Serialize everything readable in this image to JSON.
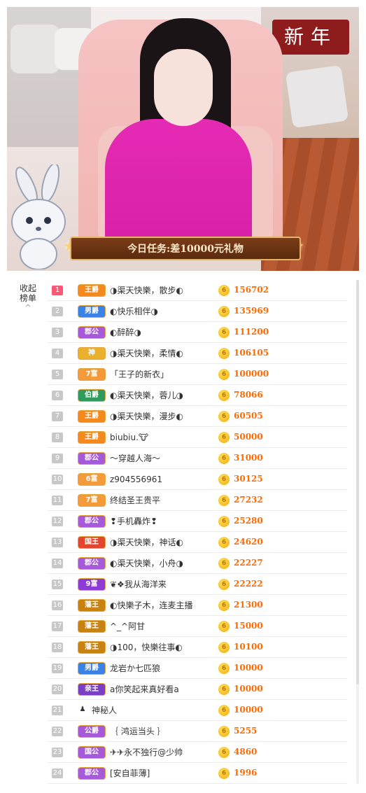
{
  "stream": {
    "task_text": "今日任务:差10000元礼物",
    "sign_text": "新年"
  },
  "sidebar": {
    "collapse_label": "收起",
    "collapse_label2": "榜单",
    "chevron": "^"
  },
  "colors": {
    "top_rank": "#ff5773",
    "amount": "#ff6a00",
    "coin": "#f5b80e"
  },
  "ranking": [
    {
      "rank": "1",
      "badge": "王爵",
      "badge_color": "#f48a1d",
      "name": "◑渠天快樂，散步◐",
      "amount": "156702"
    },
    {
      "rank": "2",
      "badge": "男爵",
      "badge_color": "#3b82e6",
      "name": "◐快乐相伴◑",
      "amount": "135969"
    },
    {
      "rank": "3",
      "badge": "郡公",
      "badge_color": "#a65ad9",
      "name": "◐醉醉◑",
      "amount": "111200"
    },
    {
      "rank": "4",
      "badge": "神",
      "badge_color": "#e9b12e",
      "name": "◑渠天快樂，柔情◐",
      "amount": "106105"
    },
    {
      "rank": "5",
      "badge": "7富",
      "badge_color": "#f39a3a",
      "name": "「王子的新衣」",
      "amount": "100000"
    },
    {
      "rank": "6",
      "badge": "伯爵",
      "badge_color": "#2e9a5c",
      "name": "◐渠天快樂，蓉儿◑",
      "amount": "78066"
    },
    {
      "rank": "7",
      "badge": "王爵",
      "badge_color": "#f48a1d",
      "name": "◑渠天快樂，漫步◐",
      "amount": "60505"
    },
    {
      "rank": "8",
      "badge": "王爵",
      "badge_color": "#f48a1d",
      "name": "biubiu.🐮",
      "amount": "50000"
    },
    {
      "rank": "9",
      "badge": "郡公",
      "badge_color": "#a65ad9",
      "name": "～穿越人海～",
      "amount": "31000"
    },
    {
      "rank": "10",
      "badge": "6富",
      "badge_color": "#f39a3a",
      "name": "z904556961",
      "amount": "30125"
    },
    {
      "rank": "11",
      "badge": "7富",
      "badge_color": "#f39a3a",
      "name": "终结圣王贵平",
      "amount": "27232"
    },
    {
      "rank": "12",
      "badge": "郡公",
      "badge_color": "#a65ad9",
      "name": "❢手机轟炸❢",
      "amount": "25280"
    },
    {
      "rank": "13",
      "badge": "国王",
      "badge_color": "#e2462f",
      "name": "◑渠天快樂，神话◐",
      "amount": "24620"
    },
    {
      "rank": "14",
      "badge": "郡公",
      "badge_color": "#a65ad9",
      "name": "◐渠天快樂，小舟◑",
      "amount": "22227"
    },
    {
      "rank": "15",
      "badge": "9富",
      "badge_color": "#8e3ad6",
      "name": "❦❖我从海洋来",
      "amount": "22222"
    },
    {
      "rank": "16",
      "badge": "藩王",
      "badge_color": "#c8820f",
      "name": "◐快樂子木，连麦主播",
      "amount": "21300"
    },
    {
      "rank": "17",
      "badge": "藩王",
      "badge_color": "#c8820f",
      "name": "^_^阿甘",
      "amount": "15000"
    },
    {
      "rank": "18",
      "badge": "藩王",
      "badge_color": "#c8820f",
      "name": "◑100，快樂往事◐",
      "amount": "10100"
    },
    {
      "rank": "19",
      "badge": "男爵",
      "badge_color": "#3b82e6",
      "name": "龙岩か七匹狼",
      "amount": "10000"
    },
    {
      "rank": "20",
      "badge": "亲王",
      "badge_color": "#7a3fc4",
      "name": "a你笑起来真好看a",
      "amount": "10000"
    },
    {
      "rank": "21",
      "badge": "",
      "badge_color": "",
      "name": "神秘人",
      "amount": "10000"
    },
    {
      "rank": "22",
      "badge": "公爵",
      "badge_color": "#a65ad9",
      "name": "｛ 鸿运当头 ｝",
      "amount": "5255"
    },
    {
      "rank": "23",
      "badge": "国公",
      "badge_color": "#a65ad9",
      "name": "✈✈永不独行@少帅",
      "amount": "4860"
    },
    {
      "rank": "24",
      "badge": "郡公",
      "badge_color": "#a65ad9",
      "name": "[安自菲薄]",
      "amount": "1996"
    }
  ]
}
